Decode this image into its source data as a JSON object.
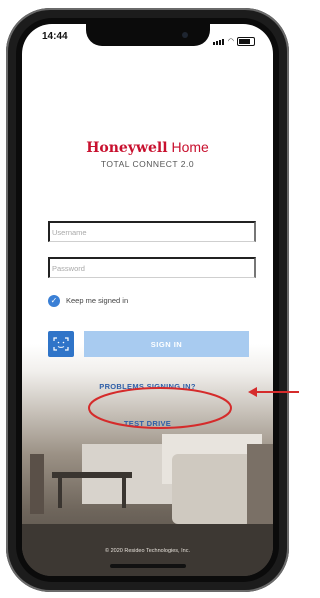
{
  "status_bar": {
    "time": "14:44"
  },
  "branding": {
    "brand_bold": "Honeywell",
    "brand_light": " Home",
    "product": "TOTAL CONNECT 2.0"
  },
  "form": {
    "username_placeholder": "Username",
    "password_placeholder": "Password",
    "keep_signed_in": "Keep me signed in",
    "sign_in_label": "SIGN IN",
    "problems_link": "PROBLEMS SIGNING IN?",
    "test_drive_link": "TEST DRIVE"
  },
  "footer": {
    "copyright": "© 2020 Resideo Technologies, Inc."
  },
  "colors": {
    "brand_red": "#c8102e",
    "accent_blue": "#2f74c8",
    "annotation_red": "#d52b2b"
  }
}
